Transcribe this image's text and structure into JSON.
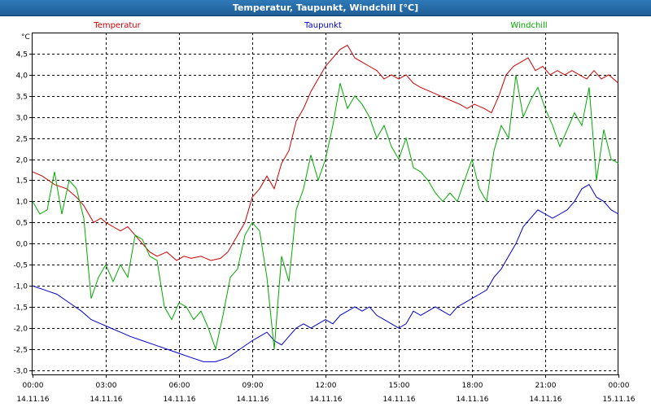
{
  "window": {
    "title": "Temperatur, Taupunkt, Windchill [°C]"
  },
  "chart_data": {
    "type": "line",
    "title": "Temperatur, Taupunkt, Windchill [°C]",
    "ylabel": "°C",
    "xlabel": "",
    "ylim": [
      -3.1,
      5.0
    ],
    "xlim": [
      0,
      24
    ],
    "grid": true,
    "legend_position": "top",
    "y_ticks": [
      "4,5",
      "4,0",
      "3,5",
      "3,0",
      "2,5",
      "2,0",
      "1,5",
      "1,0",
      "0,5",
      "0,0",
      "-0,5",
      "-1,0",
      "-1,5",
      "-2,0",
      "-2,5",
      "-3,0"
    ],
    "x_ticks": [
      {
        "time": "00:00",
        "date": "14.11.16"
      },
      {
        "time": "03:00",
        "date": "14.11.16"
      },
      {
        "time": "06:00",
        "date": "14.11.16"
      },
      {
        "time": "09:00",
        "date": "14.11.16"
      },
      {
        "time": "12:00",
        "date": "14.11.16"
      },
      {
        "time": "15:00",
        "date": "14.11.16"
      },
      {
        "time": "18:00",
        "date": "14.11.16"
      },
      {
        "time": "21:00",
        "date": "14.11.16"
      },
      {
        "time": "00:00",
        "date": "15.11.16"
      }
    ],
    "x_unit": "hours since 14.11.16 00:00",
    "series": [
      {
        "name": "Temperatur",
        "color": "#cc0000",
        "x": [
          0,
          0.4,
          0.9,
          1.4,
          1.8,
          2.1,
          2.5,
          2.8,
          3.0,
          3.3,
          3.6,
          3.9,
          4.2,
          4.5,
          4.8,
          5.1,
          5.5,
          5.9,
          6.2,
          6.5,
          6.9,
          7.3,
          7.7,
          8.0,
          8.4,
          8.7,
          9.0,
          9.3,
          9.6,
          9.9,
          10.2,
          10.5,
          10.8,
          11.1,
          11.4,
          11.7,
          12.0,
          12.3,
          12.6,
          12.9,
          13.2,
          13.5,
          13.8,
          14.1,
          14.4,
          14.7,
          15.0,
          15.3,
          15.6,
          15.9,
          16.3,
          16.7,
          17.1,
          17.5,
          17.8,
          18.1,
          18.5,
          18.8,
          19.1,
          19.4,
          19.7,
          20.0,
          20.3,
          20.6,
          20.9,
          21.2,
          21.5,
          21.8,
          22.1,
          22.4,
          22.7,
          23.0,
          23.3,
          23.6,
          24.0
        ],
        "values": [
          1.7,
          1.6,
          1.4,
          1.3,
          1.1,
          0.9,
          0.5,
          0.6,
          0.5,
          0.4,
          0.3,
          0.4,
          0.2,
          0.0,
          -0.2,
          -0.3,
          -0.2,
          -0.4,
          -0.3,
          -0.35,
          -0.3,
          -0.4,
          -0.35,
          -0.2,
          0.2,
          0.5,
          1.1,
          1.3,
          1.6,
          1.3,
          1.9,
          2.2,
          2.9,
          3.2,
          3.6,
          3.9,
          4.2,
          4.4,
          4.6,
          4.7,
          4.4,
          4.3,
          4.2,
          4.1,
          3.9,
          4.0,
          3.9,
          4.0,
          3.8,
          3.7,
          3.6,
          3.5,
          3.4,
          3.3,
          3.2,
          3.3,
          3.2,
          3.1,
          3.5,
          4.0,
          4.2,
          4.3,
          4.4,
          4.1,
          4.2,
          4.0,
          4.1,
          4.0,
          4.1,
          4.0,
          3.9,
          4.1,
          3.9,
          4.0,
          3.8
        ]
      },
      {
        "name": "Taupunkt",
        "color": "#0000cc",
        "x": [
          0,
          0.5,
          1.0,
          1.5,
          2.0,
          2.4,
          2.8,
          3.2,
          3.6,
          4.0,
          4.5,
          5.0,
          5.5,
          6.0,
          6.5,
          7.0,
          7.5,
          8.0,
          8.5,
          9.0,
          9.3,
          9.6,
          9.9,
          10.2,
          10.5,
          10.8,
          11.1,
          11.4,
          11.7,
          12.0,
          12.3,
          12.6,
          12.9,
          13.2,
          13.5,
          13.8,
          14.1,
          14.4,
          14.7,
          15.0,
          15.3,
          15.6,
          15.9,
          16.2,
          16.5,
          16.8,
          17.1,
          17.4,
          17.7,
          18.0,
          18.3,
          18.6,
          18.9,
          19.2,
          19.5,
          19.8,
          20.1,
          20.4,
          20.7,
          21.0,
          21.3,
          21.6,
          21.9,
          22.2,
          22.5,
          22.8,
          23.1,
          23.4,
          23.7,
          24.0
        ],
        "values": [
          -1.0,
          -1.1,
          -1.2,
          -1.4,
          -1.6,
          -1.8,
          -1.9,
          -2.0,
          -2.1,
          -2.2,
          -2.3,
          -2.4,
          -2.5,
          -2.6,
          -2.7,
          -2.8,
          -2.8,
          -2.7,
          -2.5,
          -2.3,
          -2.2,
          -2.1,
          -2.3,
          -2.4,
          -2.2,
          -2.0,
          -1.9,
          -2.0,
          -1.9,
          -1.8,
          -1.9,
          -1.7,
          -1.6,
          -1.5,
          -1.6,
          -1.5,
          -1.7,
          -1.8,
          -1.9,
          -2.0,
          -1.9,
          -1.6,
          -1.7,
          -1.6,
          -1.5,
          -1.6,
          -1.7,
          -1.5,
          -1.4,
          -1.3,
          -1.2,
          -1.1,
          -0.8,
          -0.6,
          -0.3,
          0.0,
          0.4,
          0.6,
          0.8,
          0.7,
          0.6,
          0.7,
          0.8,
          1.0,
          1.3,
          1.4,
          1.1,
          1.0,
          0.8,
          0.7
        ]
      },
      {
        "name": "Windchill",
        "color": "#00aa00",
        "x": [
          0,
          0.3,
          0.6,
          0.9,
          1.2,
          1.5,
          1.8,
          2.1,
          2.4,
          2.7,
          3.0,
          3.3,
          3.6,
          3.9,
          4.2,
          4.5,
          4.8,
          5.1,
          5.4,
          5.7,
          6.0,
          6.3,
          6.6,
          6.9,
          7.2,
          7.5,
          7.8,
          8.1,
          8.4,
          8.7,
          9.0,
          9.3,
          9.6,
          9.9,
          10.2,
          10.5,
          10.8,
          11.1,
          11.4,
          11.7,
          12.0,
          12.3,
          12.6,
          12.9,
          13.2,
          13.5,
          13.8,
          14.1,
          14.4,
          14.7,
          15.0,
          15.3,
          15.6,
          15.9,
          16.2,
          16.5,
          16.8,
          17.1,
          17.4,
          17.7,
          18.0,
          18.3,
          18.6,
          18.9,
          19.2,
          19.5,
          19.8,
          20.1,
          20.4,
          20.7,
          21.0,
          21.3,
          21.6,
          21.9,
          22.2,
          22.5,
          22.8,
          23.1,
          23.4,
          23.7,
          24.0
        ],
        "values": [
          1.0,
          0.7,
          0.8,
          1.7,
          0.7,
          1.5,
          1.3,
          0.6,
          -1.3,
          -0.8,
          -0.5,
          -0.9,
          -0.5,
          -0.8,
          0.2,
          0.1,
          -0.3,
          -0.4,
          -1.5,
          -1.8,
          -1.4,
          -1.5,
          -1.8,
          -1.6,
          -2.0,
          -2.5,
          -1.7,
          -0.8,
          -0.6,
          0.2,
          0.5,
          0.3,
          -0.8,
          -2.5,
          -0.3,
          -0.9,
          0.8,
          1.3,
          2.1,
          1.5,
          2.0,
          2.8,
          3.8,
          3.2,
          3.5,
          3.3,
          3.0,
          2.5,
          2.8,
          2.3,
          2.0,
          2.5,
          1.8,
          1.7,
          1.5,
          1.2,
          1.0,
          1.2,
          1.0,
          1.5,
          2.0,
          1.3,
          1.0,
          2.2,
          2.8,
          2.5,
          4.0,
          3.0,
          3.4,
          3.7,
          3.2,
          2.8,
          2.3,
          2.7,
          3.1,
          2.8,
          3.7,
          1.5,
          2.7,
          2.0,
          1.9
        ]
      }
    ]
  }
}
